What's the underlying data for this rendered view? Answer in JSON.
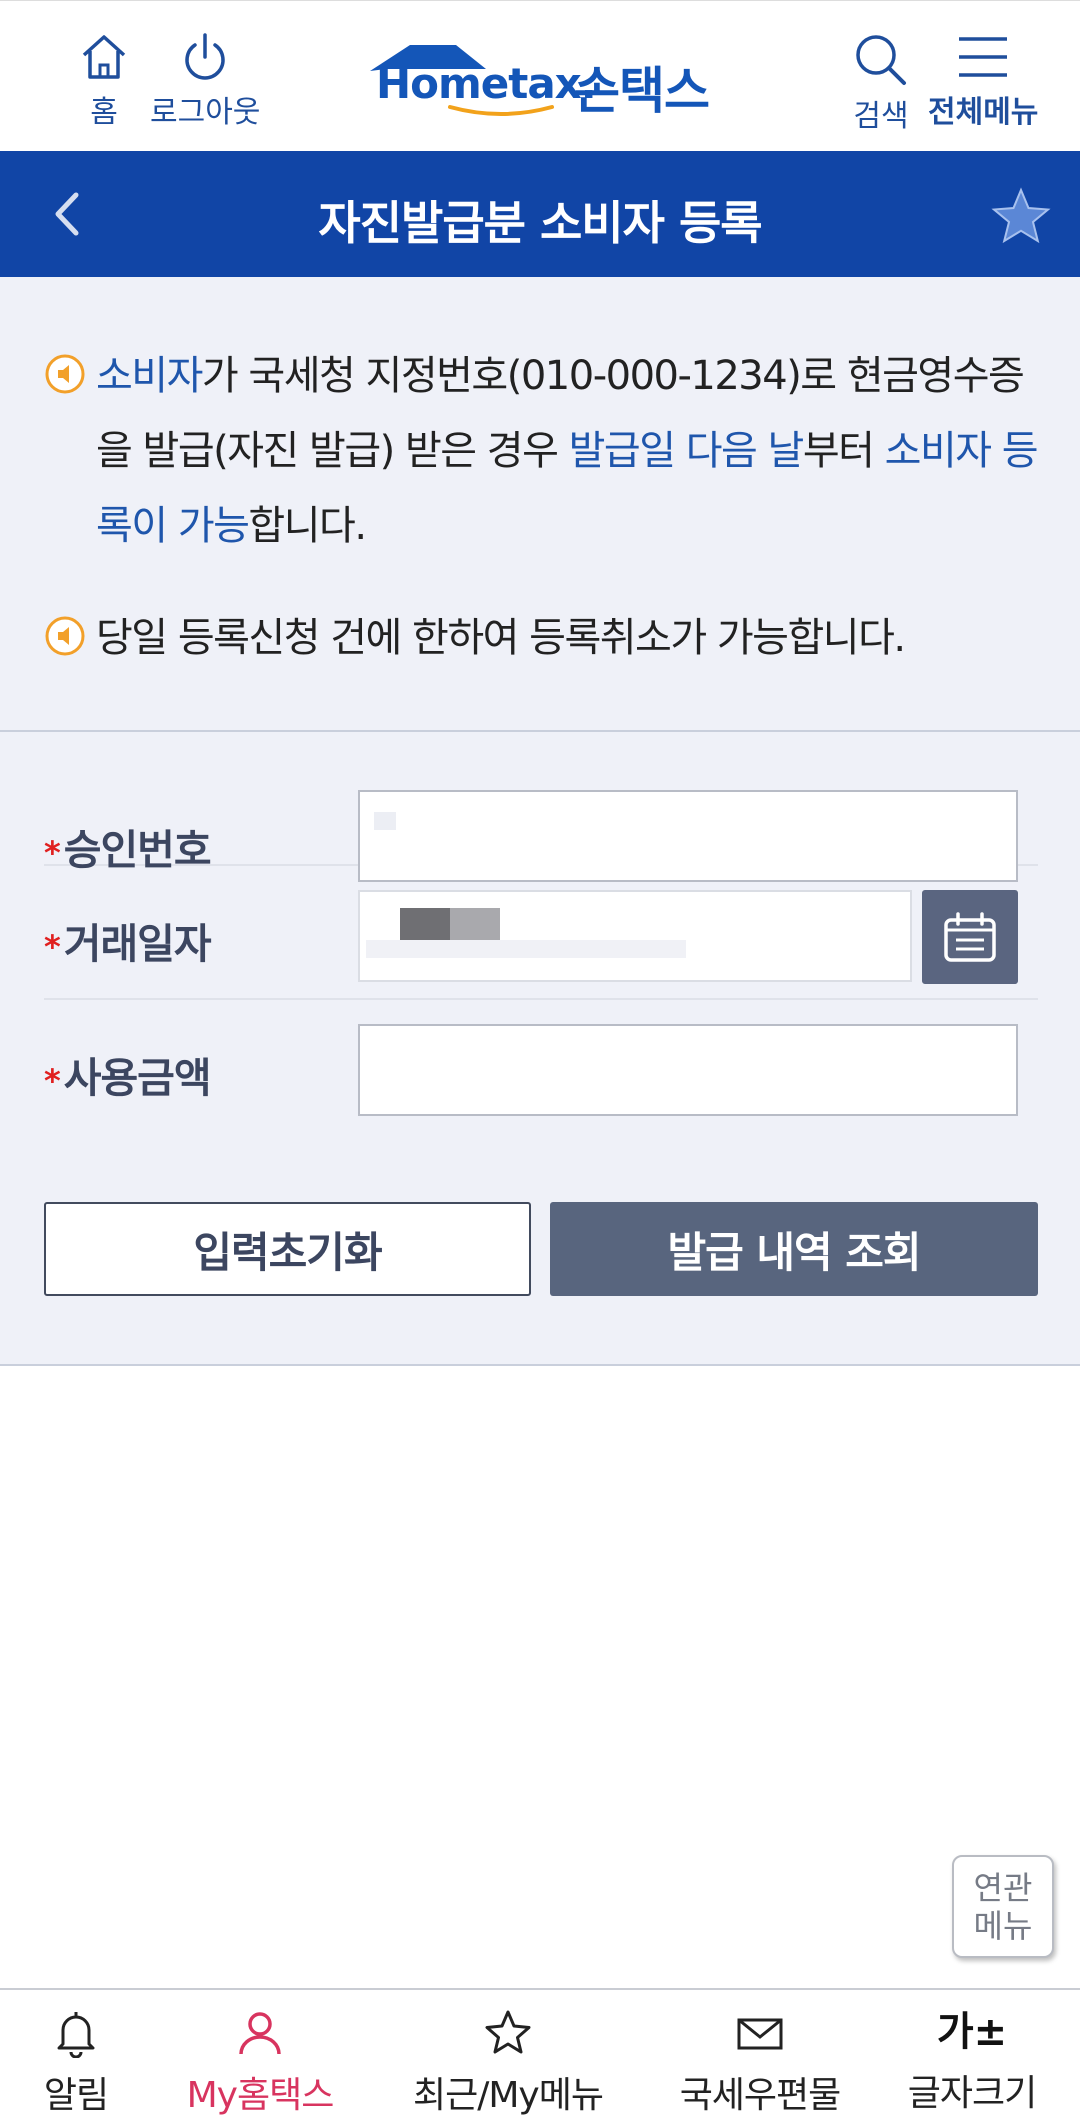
{
  "header": {
    "home_label": "홈",
    "logout_label": "로그아웃",
    "logo_en": "Hometax.",
    "logo_ko": "손택스",
    "search_label": "검색",
    "menu_label": "전체메뉴"
  },
  "titlebar": {
    "title": "자진발급분 소비자 등록"
  },
  "notice": {
    "line1": {
      "a": "소비자",
      "b": "가 국세청 지정번호(010-000-1234)로 현금영수증을 발급(자진 발급) 받은 경우 ",
      "c": "발급일 다음 날",
      "d": "부터 ",
      "e": "소비자 등록이 가능",
      "f": "합니다."
    },
    "line2": "당일 등록신청 건에 한하여 등록취소가 가능합니다."
  },
  "form": {
    "required_mark": "*",
    "approval_label": "승인번호",
    "date_label": "거래일자",
    "amount_label": "사용금액",
    "reset_button": "입력초기화",
    "search_button": "발급 내역 조회"
  },
  "related_menu": {
    "line1": "연관",
    "line2": "메뉴"
  },
  "bottom_nav": {
    "items": [
      {
        "label": "알림",
        "icon": "bell-icon"
      },
      {
        "label": "My홈택스",
        "icon": "person-icon"
      },
      {
        "label": "최근/My메뉴",
        "icon": "star-icon"
      },
      {
        "label": "국세우편물",
        "icon": "mail-icon"
      },
      {
        "label": "글자크기",
        "icon": "text-size-icon",
        "glyph": "가±"
      }
    ]
  },
  "colors": {
    "brand_blue": "#1145a6",
    "highlight_blue": "#1f56ac",
    "button_slate": "#58657e",
    "required_red": "#e02020",
    "active_pink": "#d8345f",
    "notice_bg": "#eff1f8"
  }
}
